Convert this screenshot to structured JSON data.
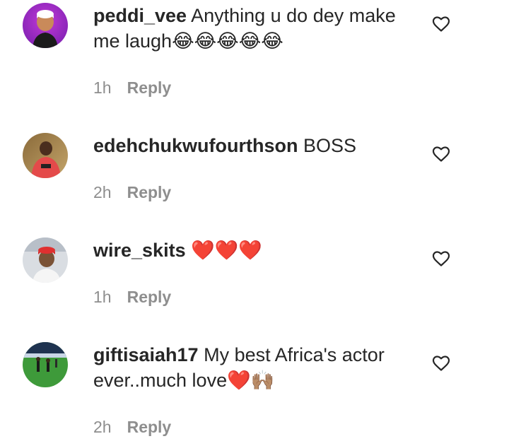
{
  "comments": [
    {
      "username": "peddi_vee",
      "text": "Anything u do dey make me laugh😂😂😂😂😂",
      "time": "1h",
      "reply_label": "Reply",
      "avatar_icon": "purple-cartoon-avatar",
      "like_icon": "heart-outline-icon"
    },
    {
      "username": "edehchukwufourthson",
      "text": "BOSS",
      "time": "2h",
      "reply_label": "Reply",
      "avatar_icon": "person-photo-avatar",
      "like_icon": "heart-outline-icon"
    },
    {
      "username": "wire_skits",
      "text": "❤️❤️❤️",
      "time": "1h",
      "reply_label": "Reply",
      "avatar_icon": "person-red-cap-avatar",
      "like_icon": "heart-outline-icon"
    },
    {
      "username": "giftisaiah17",
      "text": "My best Africa's actor ever..much love❤️🙌🏽",
      "time": "2h",
      "reply_label": "Reply",
      "avatar_icon": "football-field-avatar",
      "like_icon": "heart-outline-icon"
    }
  ],
  "colors": {
    "username": "#262626",
    "text": "#262626",
    "meta": "#8e8e8e"
  }
}
